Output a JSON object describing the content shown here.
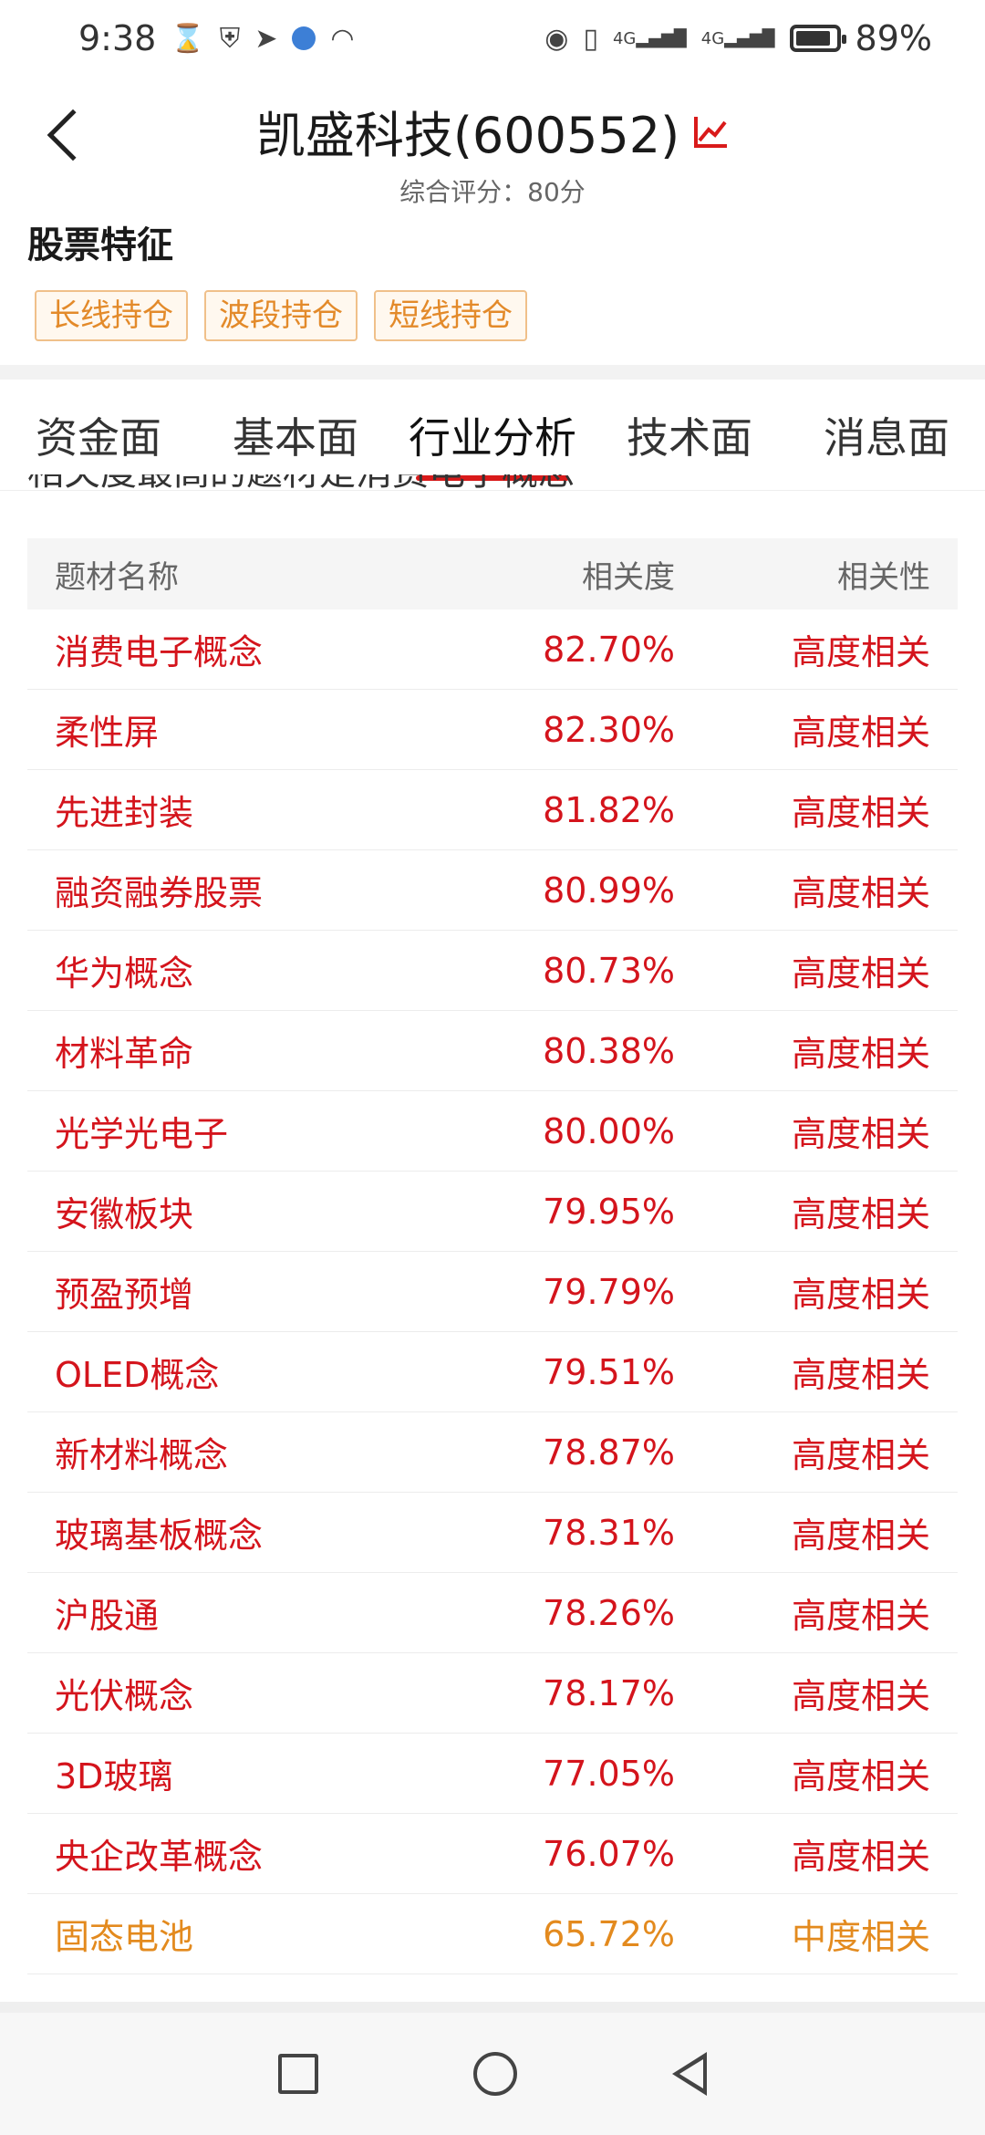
{
  "status_bar": {
    "time": "9:38",
    "battery": "89%",
    "battery_level": 0.89,
    "signal1": "4G",
    "signal2": "4G"
  },
  "header": {
    "title": "凯盛科技(600552)",
    "subtitle": "综合评分：80分",
    "accent_color": "#d91a1a"
  },
  "features": {
    "title": "股票特征",
    "tags": [
      "长线持仓",
      "波段持仓",
      "短线持仓"
    ]
  },
  "tabs": [
    "资金面",
    "基本面",
    "行业分析",
    "技术面",
    "消息面"
  ],
  "active_tab": "行业分析",
  "partial_text": "相关度最高的题材是消费电子概念",
  "table": {
    "headers": {
      "name": "题材名称",
      "score": "相关度",
      "relevance": "相关性"
    },
    "rows": [
      {
        "name": "消费电子概念",
        "score": "82.70%",
        "relevance": "高度相关"
      },
      {
        "name": "柔性屏",
        "score": "82.30%",
        "relevance": "高度相关"
      },
      {
        "name": "先进封装",
        "score": "81.82%",
        "relevance": "高度相关"
      },
      {
        "name": "融资融券股票",
        "score": "80.99%",
        "relevance": "高度相关"
      },
      {
        "name": "华为概念",
        "score": "80.73%",
        "relevance": "高度相关"
      },
      {
        "name": "材料革命",
        "score": "80.38%",
        "relevance": "高度相关"
      },
      {
        "name": "光学光电子",
        "score": "80.00%",
        "relevance": "高度相关"
      },
      {
        "name": "安徽板块",
        "score": "79.95%",
        "relevance": "高度相关"
      },
      {
        "name": "预盈预增",
        "score": "79.79%",
        "relevance": "高度相关"
      },
      {
        "name": "OLED概念",
        "score": "79.51%",
        "relevance": "高度相关"
      },
      {
        "name": "新材料概念",
        "score": "78.87%",
        "relevance": "高度相关"
      },
      {
        "name": "玻璃基板概念",
        "score": "78.31%",
        "relevance": "高度相关"
      },
      {
        "name": "沪股通",
        "score": "78.26%",
        "relevance": "高度相关"
      },
      {
        "name": "光伏概念",
        "score": "78.17%",
        "relevance": "高度相关"
      },
      {
        "name": "3D玻璃",
        "score": "77.05%",
        "relevance": "高度相关"
      },
      {
        "name": "央企改革概念",
        "score": "76.07%",
        "relevance": "高度相关"
      },
      {
        "name": "固态电池",
        "score": "65.72%",
        "relevance": "中度相关"
      }
    ]
  },
  "colors": {
    "high": "#d4141c",
    "medium": "#e38a1e"
  }
}
